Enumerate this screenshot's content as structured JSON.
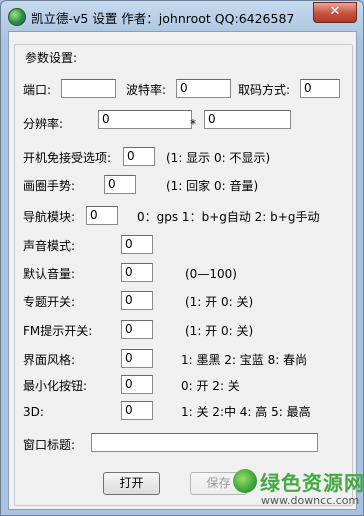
{
  "window": {
    "title": "凯立德-v5 设置 作者：johnroot QQ:6426587",
    "close_glyph": "✕"
  },
  "group": {
    "label": "参数设置:"
  },
  "port_row": {
    "port_label": "端口:",
    "port_value": "",
    "baud_label": "波特率:",
    "baud_value": "0",
    "code_label": "取码方式:",
    "code_value": "0"
  },
  "resolution": {
    "label": "分辨率:",
    "width_value": "0",
    "times": "*",
    "height_value": "0"
  },
  "settings": [
    {
      "label": "开机免接受选项:",
      "value": "0",
      "hint": "(1: 显示 0: 不显示)"
    },
    {
      "label": "画圈手势:",
      "value": "0",
      "hint": "(1: 回家 0: 音量)"
    },
    {
      "label": "导航模块:",
      "value": "0",
      "hint": "0：gps 1：b+g自动 2: b+g手动"
    },
    {
      "label": "声音模式:",
      "value": "0",
      "hint": ""
    },
    {
      "label": "默认音量:",
      "value": "0",
      "hint": "(0—100)"
    },
    {
      "label": "专题开关:",
      "value": "0",
      "hint": "(1: 开 0: 关)"
    },
    {
      "label": "FM提示开关:",
      "value": "0",
      "hint": "(1: 开 0: 关)"
    },
    {
      "label": "界面风格:",
      "value": "0",
      "hint": "1: 墨黑 2: 宝蓝 8: 春尚"
    },
    {
      "label": "最小化按钮:",
      "value": "0",
      "hint": "0: 开 2: 关"
    },
    {
      "label": "3D:",
      "value": "0",
      "hint": "1: 关 2:中 4: 高 5: 最高"
    }
  ],
  "window_title_field": {
    "label": "窗口标题:",
    "value": ""
  },
  "buttons": {
    "open": "打开",
    "save": "保存"
  },
  "watermark": {
    "text": "绿色资源网",
    "url": "www.downcc.com"
  }
}
